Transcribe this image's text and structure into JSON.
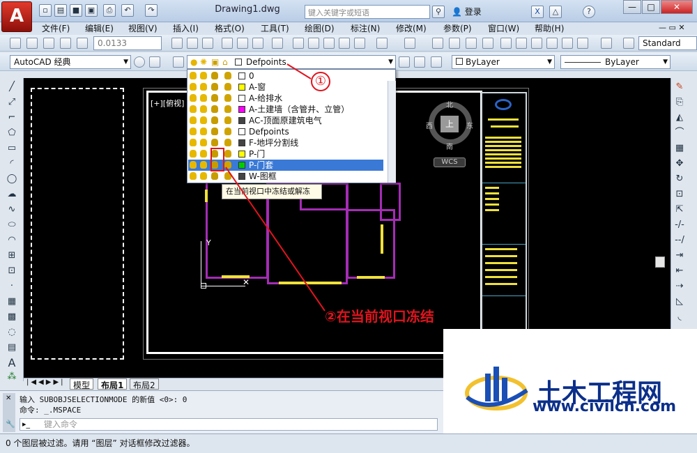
{
  "app": {
    "logo": "A",
    "document_title": "Drawing1.dwg",
    "search_placeholder": "键入关键字或短语",
    "login_label": "登录"
  },
  "menubar": [
    "文件(F)",
    "编辑(E)",
    "视图(V)",
    "插入(I)",
    "格式(O)",
    "工具(T)",
    "绘图(D)",
    "标注(N)",
    "修改(M)",
    "参数(P)",
    "窗口(W)",
    "帮助(H)"
  ],
  "toolbar": {
    "lineweight_value": "0.0133",
    "text_style": "Standard"
  },
  "toolbar2": {
    "workspace": "AutoCAD 经典",
    "current_layer": "Defpoints",
    "color": "ByLayer",
    "linetype": "ByLayer"
  },
  "layers": [
    {
      "name": "0",
      "color": "#ffffff"
    },
    {
      "name": "A-窗",
      "color": "#ffff00"
    },
    {
      "name": "A-给排水",
      "color": "#ffffff"
    },
    {
      "name": "A-土建墙（含管井、立管）",
      "color": "#ff00ff"
    },
    {
      "name": "AC-顶面原建筑电气",
      "color": "#444444"
    },
    {
      "name": "Defpoints",
      "color": "#ffffff"
    },
    {
      "name": "F-地坪分割线",
      "color": "#444444"
    },
    {
      "name": "P-门",
      "color": "#ffff00"
    },
    {
      "name": "P-门套",
      "color": "#00cc00"
    },
    {
      "name": "W-图框",
      "color": "#444444"
    }
  ],
  "selected_layer_index": 8,
  "tooltip": "在当前视口中冻结或解冻",
  "viewport_label": "[+][俯视]",
  "compass": {
    "north": "北",
    "south": "南",
    "east": "东",
    "west": "西",
    "center": "上",
    "wcs": "WCS"
  },
  "tabs": [
    "模型",
    "布局1",
    "布局2"
  ],
  "command": {
    "history_1": "输入 SUBOBJSELECTIONMODE 的新值 <0>: 0",
    "history_2": "命令: _.MSPACE",
    "prompt_placeholder": "键入命令"
  },
  "status": "0 个图层被过滤。请用 “图层” 对话框修改过滤器。",
  "annotations": {
    "step1": "①",
    "step2": "②在当前视口冻结"
  },
  "watermark": {
    "title": "土木工程网",
    "url": "www.civilcn.com"
  },
  "colors": {
    "canvas": "#000000",
    "wall": "#a52cb5",
    "window": "#f0e13a",
    "annotation": "#e0141e",
    "watermark": "#0b2f8a"
  }
}
